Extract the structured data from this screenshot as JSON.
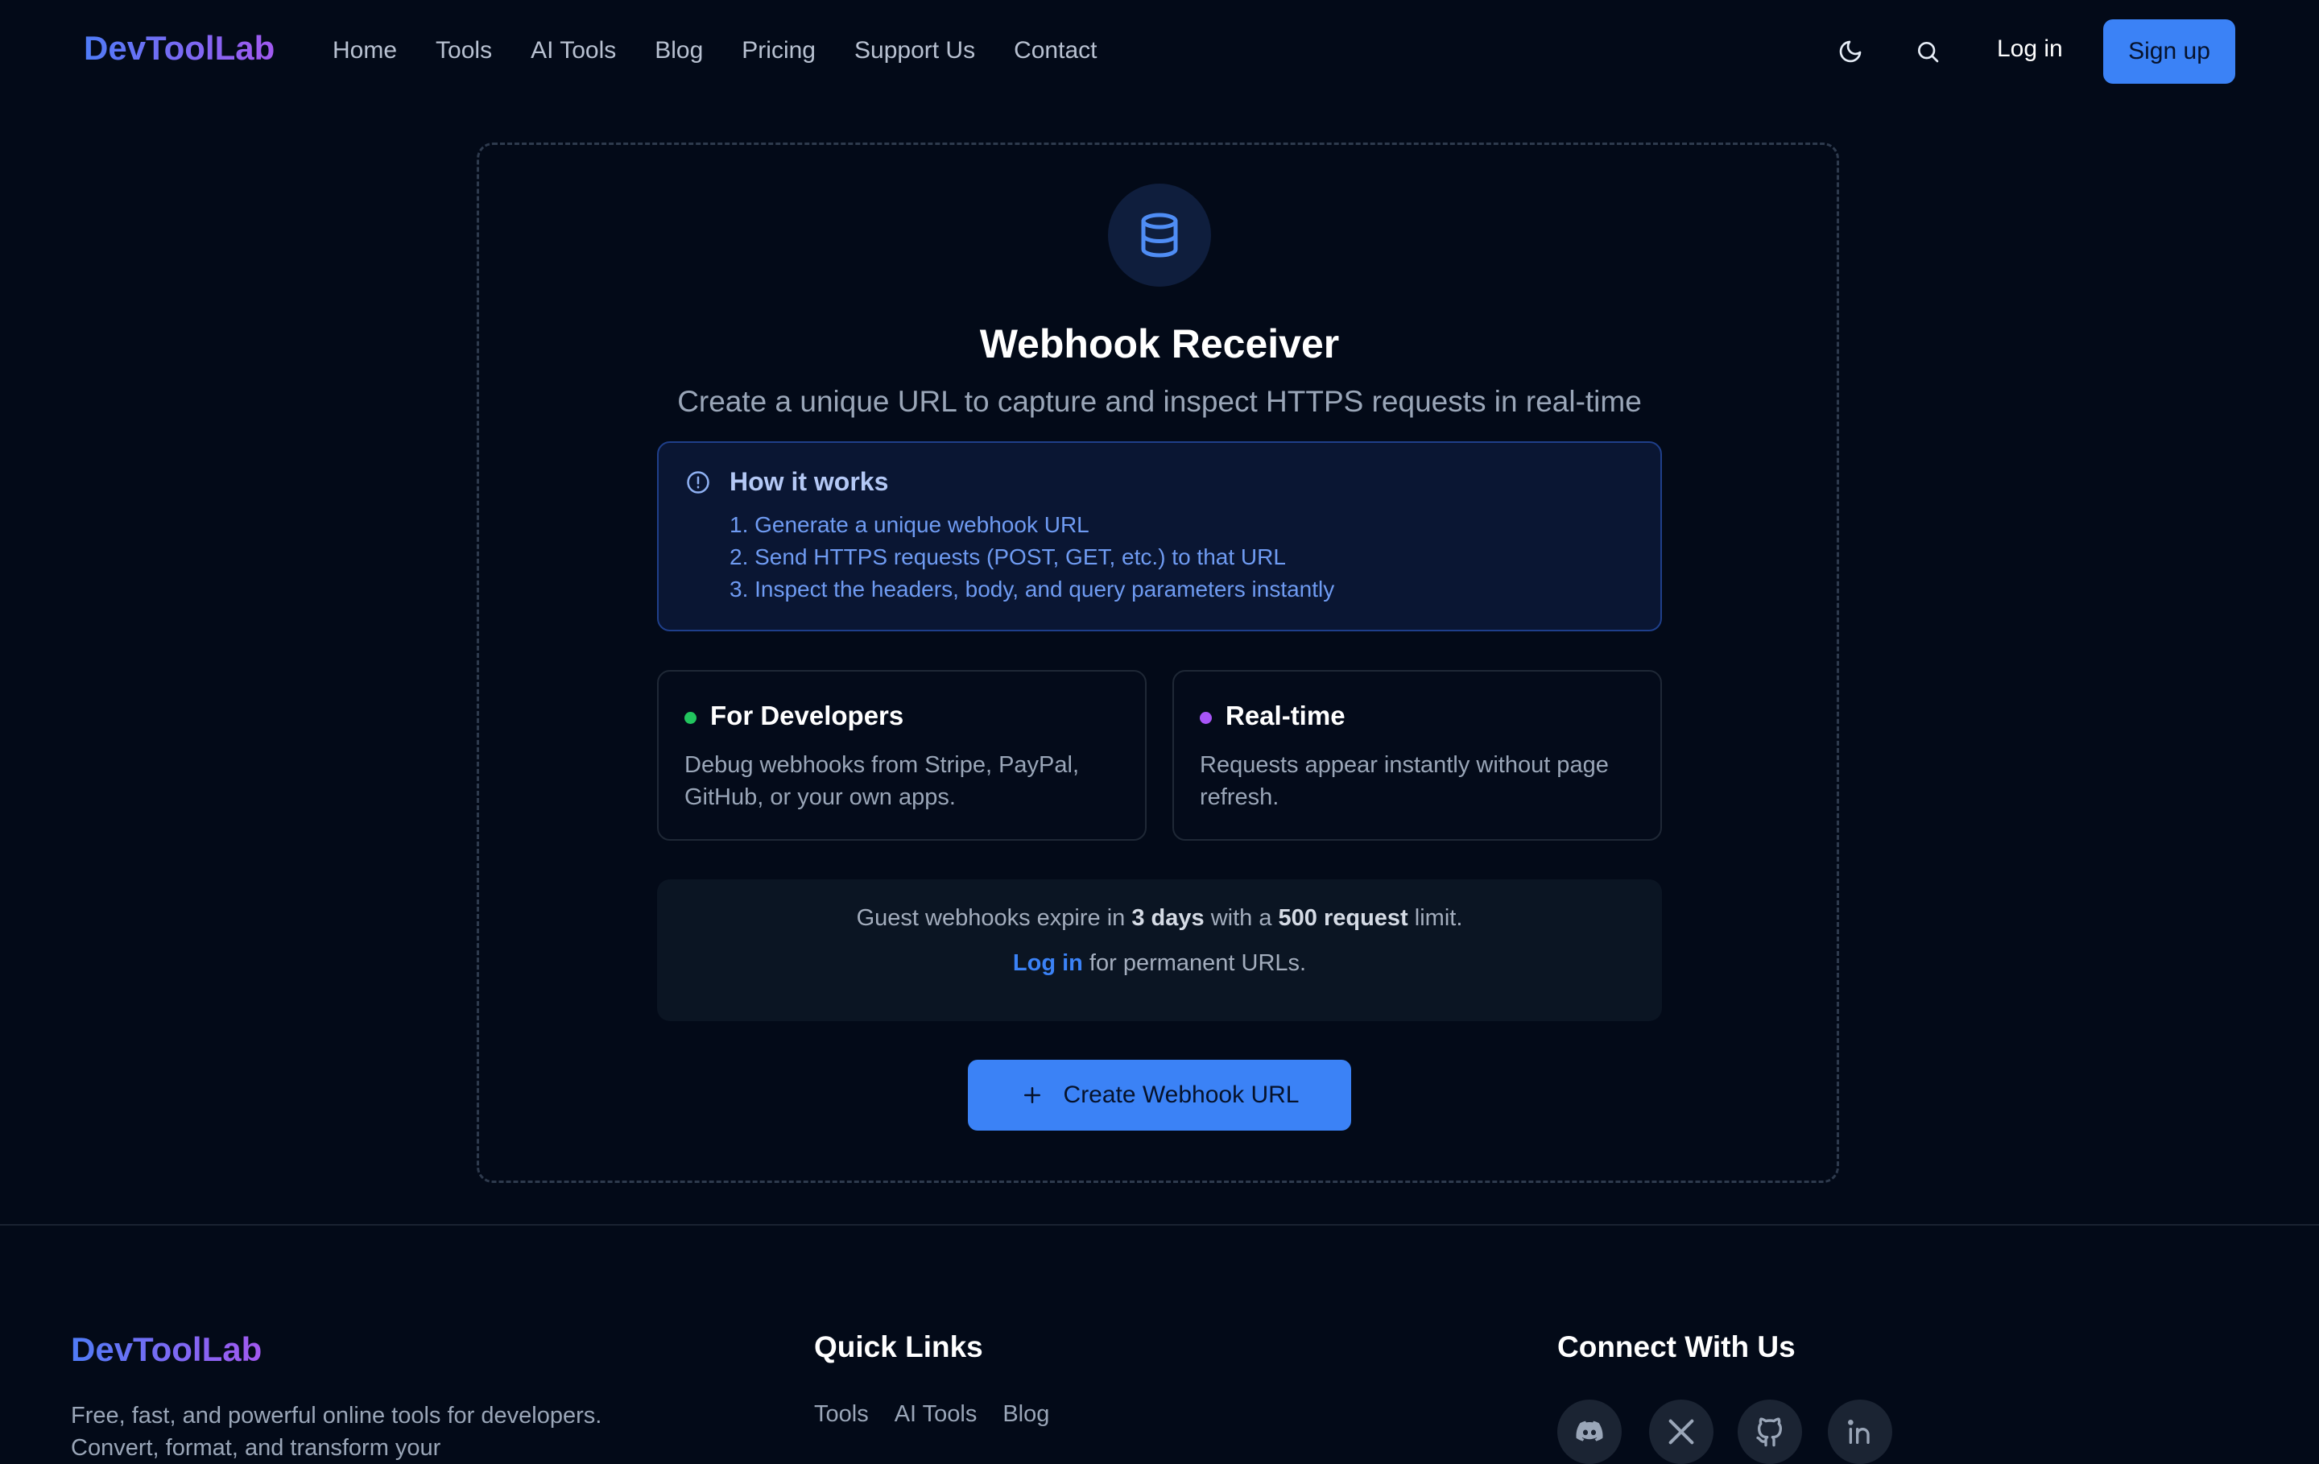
{
  "nav": {
    "logo": "DevToolLab",
    "links": [
      "Home",
      "Tools",
      "AI Tools",
      "Blog",
      "Pricing",
      "Support Us",
      "Contact"
    ],
    "theme_icon": "moon-icon",
    "search_icon": "search-icon",
    "login": "Log in",
    "signup": "Sign up"
  },
  "main": {
    "hero_icon": "database-icon",
    "title": "Webhook Receiver",
    "subtitle": "Create a unique URL to capture and inspect HTTPS requests in real-time",
    "how": {
      "icon": "info-circle-icon",
      "title": "How it works",
      "steps": [
        "1. Generate a unique webhook URL",
        "2. Send HTTPS requests (POST, GET, etc.) to that URL",
        "3. Inspect the headers, body, and query parameters instantly"
      ]
    },
    "features": [
      {
        "title": "For Developers",
        "desc": "Debug webhooks from Stripe, PayPal, GitHub, or your own apps.",
        "dot_color": "#22c55e"
      },
      {
        "title": "Real-time",
        "desc": "Requests appear instantly without page refresh.",
        "dot_color": "#a855f7"
      }
    ],
    "notice": {
      "pre": "Guest webhooks expire in ",
      "days": "3 days",
      "mid": " with a ",
      "limit": "500 request",
      "post": " limit.",
      "login_link": "Log in",
      "login_post": " for permanent URLs."
    },
    "create_button": "Create Webhook URL"
  },
  "footer": {
    "logo": "DevToolLab",
    "desc": "Free, fast, and powerful online tools for developers. Convert, format, and transform your",
    "quick_links_title": "Quick Links",
    "quick_links": [
      "Tools",
      "AI Tools",
      "Blog"
    ],
    "connect_title": "Connect With Us",
    "social_icons": [
      "discord-icon",
      "x-icon",
      "github-icon",
      "linkedin-icon"
    ]
  },
  "colors": {
    "accent": "#3b82f6",
    "background": "#030a18"
  }
}
